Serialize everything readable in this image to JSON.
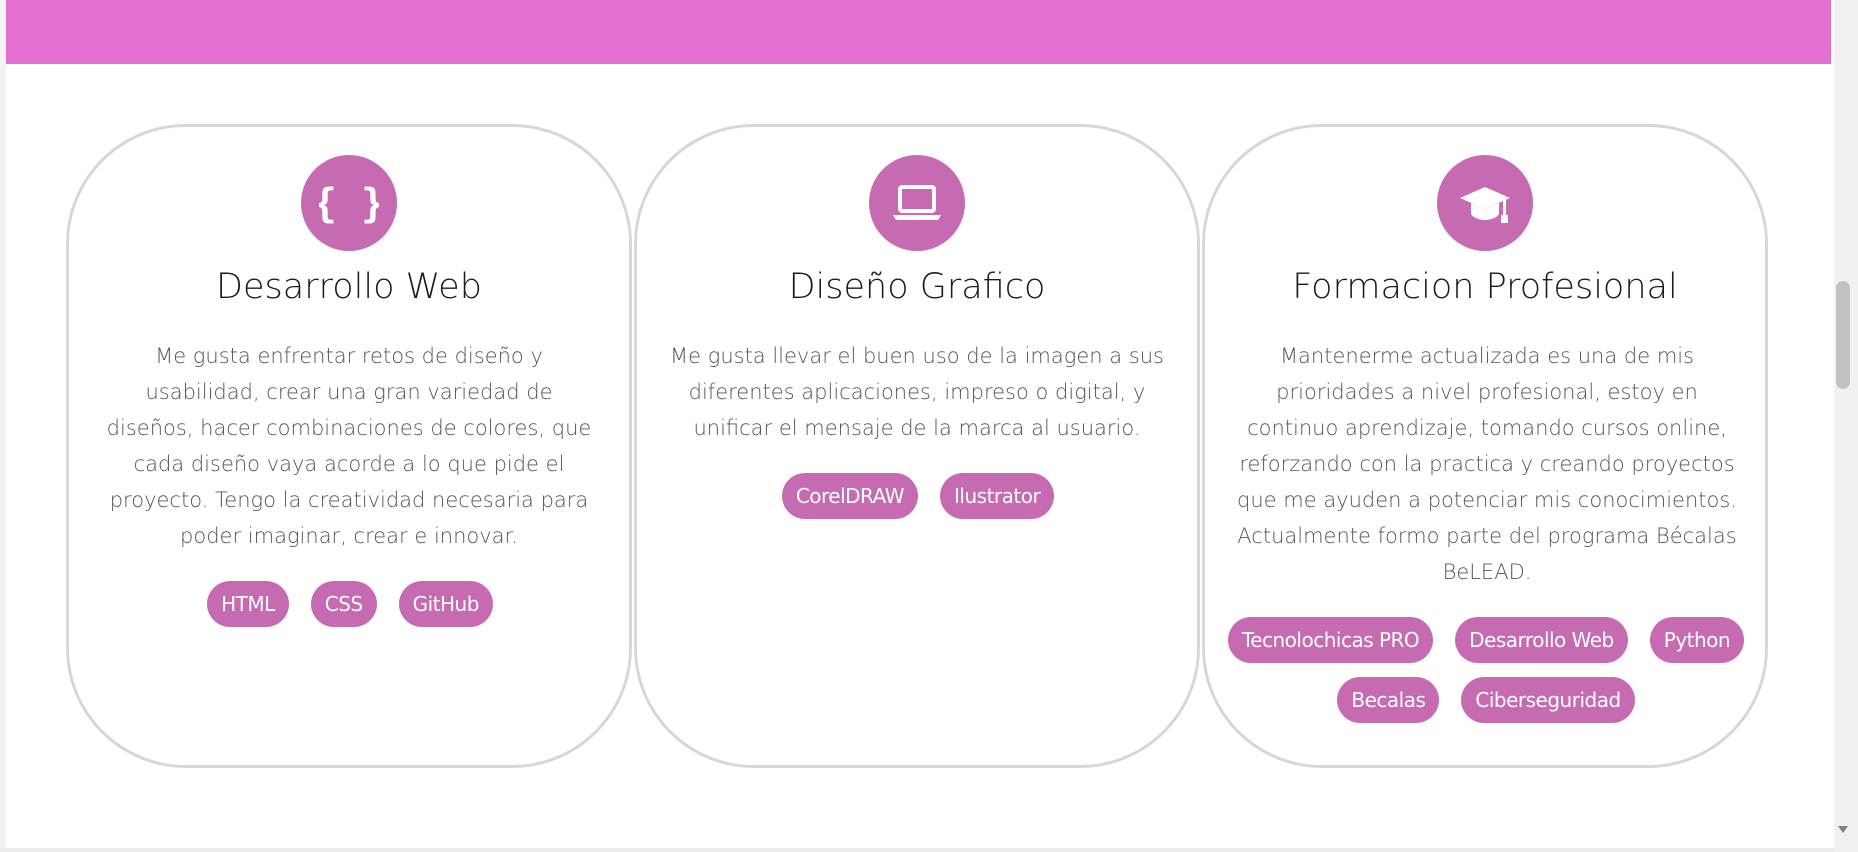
{
  "colors": {
    "header_band": "#e46fd3",
    "accent": "#c66bb2",
    "card_border": "#d7d7d7",
    "title_text": "#1b1b1b",
    "body_text": "#555555"
  },
  "cards": [
    {
      "icon": "code-braces-icon",
      "icon_glyph": "{ }",
      "title": "Desarrollo Web",
      "text": "Me gusta enfrentar retos de diseño y usabilidad, crear una gran variedad de diseños, hacer combinaciones de colores, que cada diseño vaya acorde a lo que pide el proyecto. Tengo la creatividad necesaria para poder imaginar, crear e innovar.",
      "tags": [
        "HTML",
        "CSS",
        "GitHub"
      ]
    },
    {
      "icon": "laptop-icon",
      "title": "Diseño Grafico",
      "text": "Me gusta llevar el buen uso de la imagen a sus diferentes aplicaciones, impreso o digital, y unificar el mensaje de la marca al usuario.",
      "tags": [
        "CorelDRAW",
        "Ilustrator"
      ]
    },
    {
      "icon": "graduation-cap-icon",
      "title": "Formacion Profesional",
      "text": "Mantenerme actualizada es una de mis prioridades a nivel profesional, estoy en continuo aprendizaje, tomando cursos online, reforzando con la practica y creando proyectos que me ayuden a potenciar mis conocimientos. Actualmente formo parte del programa Bécalas BeLEAD.",
      "tags": [
        "Tecnolochicas PRO",
        "Desarrollo Web",
        "Python",
        "Becalas",
        "Ciberseguridad"
      ]
    }
  ]
}
